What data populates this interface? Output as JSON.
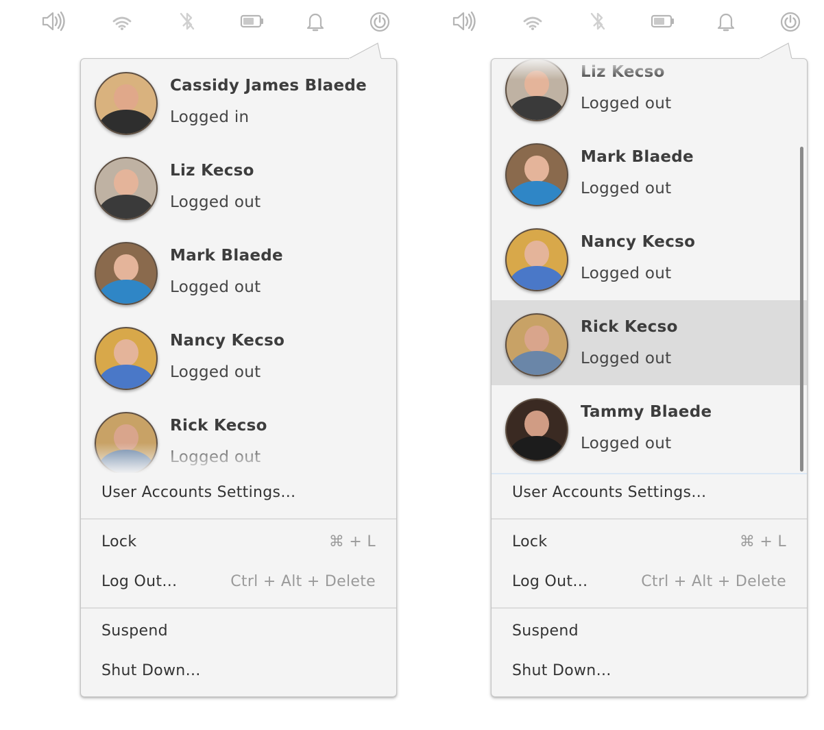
{
  "panels": [
    {
      "users": [
        {
          "name": "Cassidy James Blaede",
          "status": "Logged in"
        },
        {
          "name": "Liz Kecso",
          "status": "Logged out"
        },
        {
          "name": "Mark Blaede",
          "status": "Logged out"
        },
        {
          "name": "Nancy Kecso",
          "status": "Logged out"
        },
        {
          "name": "Rick Kecso",
          "status": "Logged out"
        }
      ],
      "selected_user": "",
      "scrollbar_visible": false
    },
    {
      "users": [
        {
          "name": "Liz Kecso",
          "status": "Logged out"
        },
        {
          "name": "Mark Blaede",
          "status": "Logged out"
        },
        {
          "name": "Nancy Kecso",
          "status": "Logged out"
        },
        {
          "name": "Rick Kecso",
          "status": "Logged out"
        },
        {
          "name": "Tammy Blaede",
          "status": "Logged out"
        }
      ],
      "selected_user": "Rick Kecso",
      "scrollbar_visible": true
    }
  ],
  "tray_icons": [
    "volume-icon",
    "wifi-icon",
    "bluetooth-disabled-icon",
    "battery-icon",
    "notifications-bell-icon",
    "power-icon"
  ],
  "menu": {
    "user_accounts_settings": "User Accounts Settings…",
    "lock": "Lock",
    "lock_shortcut": "⌘ + L",
    "log_out": "Log Out…",
    "log_out_shortcut": "Ctrl + Alt + Delete",
    "suspend": "Suspend",
    "shut_down": "Shut Down…"
  },
  "colors": {
    "popover_bg": "#f4f4f4",
    "selected_row": "#dcdcdc",
    "text": "#333333",
    "accelerator": "#9a9a9a",
    "icon": "#b8b8b8"
  }
}
